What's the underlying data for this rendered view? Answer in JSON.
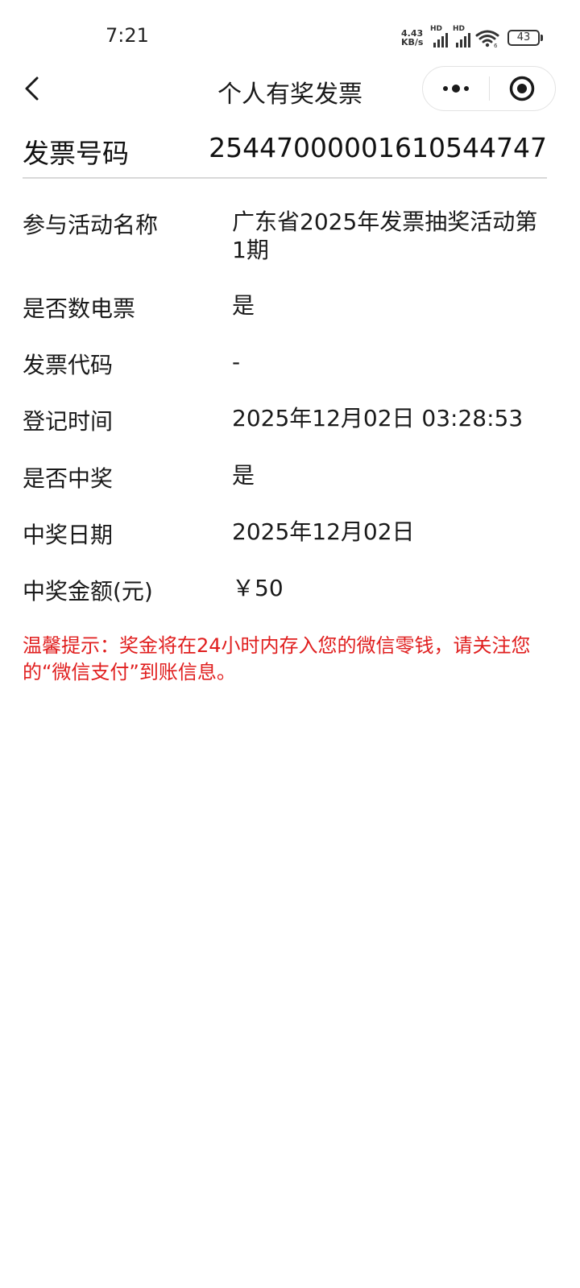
{
  "status_bar": {
    "time": "7:21",
    "net_speed_value": "4.43",
    "net_speed_unit": "KB/s",
    "sim1_label": "HD",
    "sim2_label": "HD",
    "wifi_index": "6",
    "battery": "43"
  },
  "nav": {
    "title": "个人有奖发票"
  },
  "invoice": {
    "number_label": "发票号码",
    "number_value": "25447000001610544747"
  },
  "details": [
    {
      "label": "参与活动名称",
      "value": "广东省2025年发票抽奖活动第1期"
    },
    {
      "label": "是否数电票",
      "value": "是"
    },
    {
      "label": "发票代码",
      "value": "-"
    },
    {
      "label": "登记时间",
      "value": "2025年12月02日 03:28:53"
    },
    {
      "label": "是否中奖",
      "value": "是"
    },
    {
      "label": "中奖日期",
      "value": "2025年12月02日"
    },
    {
      "label": "中奖金额(元)",
      "value": "￥50"
    }
  ],
  "tip": {
    "text": "温馨提示：奖金将在24小时内存入您的微信零钱，请关注您的“微信支付”到账信息。"
  },
  "colors": {
    "tip": "#e01e1e",
    "text": "#1a1a1a",
    "divider": "#d9d9d9"
  }
}
